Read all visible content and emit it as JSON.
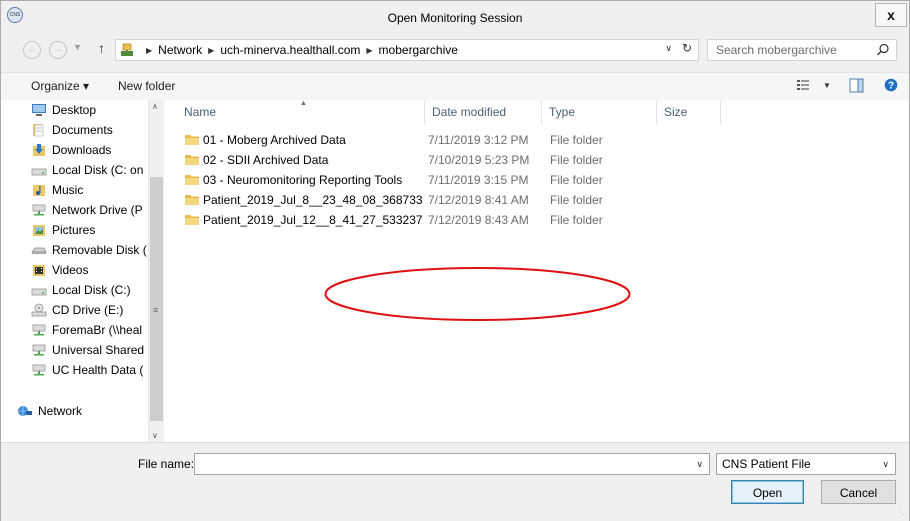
{
  "window": {
    "title": "Open Monitoring Session",
    "app_icon_text": "CNS",
    "close_label": "x"
  },
  "navbar": {
    "back_icon": "back-arrow-icon",
    "forward_icon": "forward-arrow-icon",
    "up_icon": "up-arrow-icon",
    "breadcrumbs": [
      "Network",
      "uch-minerva.healthall.com",
      "mobergarchive"
    ],
    "search_placeholder": "Search mobergarchive"
  },
  "toolbar": {
    "organize_label": "Organize ▾",
    "new_folder_label": "New folder"
  },
  "sidebar": {
    "items": [
      {
        "label": "Desktop",
        "icon": "desktop-icon"
      },
      {
        "label": "Documents",
        "icon": "documents-icon"
      },
      {
        "label": "Downloads",
        "icon": "downloads-icon"
      },
      {
        "label": "Local Disk (C: on",
        "icon": "drive-icon"
      },
      {
        "label": "Music",
        "icon": "music-icon"
      },
      {
        "label": "Network Drive (P",
        "icon": "network-drive-icon"
      },
      {
        "label": "Pictures",
        "icon": "pictures-icon"
      },
      {
        "label": "Removable Disk (",
        "icon": "removable-disk-icon"
      },
      {
        "label": "Videos",
        "icon": "videos-icon"
      },
      {
        "label": "Local Disk (C:)",
        "icon": "drive-icon"
      },
      {
        "label": "CD Drive (E:)",
        "icon": "cd-drive-icon"
      },
      {
        "label": "ForemaBr (\\\\heal",
        "icon": "network-drive-icon"
      },
      {
        "label": "Universal Shared",
        "icon": "network-drive-icon"
      },
      {
        "label": "UC Health Data (",
        "icon": "network-drive-icon"
      },
      {
        "label": "Network",
        "icon": "network-icon"
      }
    ]
  },
  "file_list": {
    "columns": [
      "Name",
      "Date modified",
      "Type",
      "Size"
    ],
    "rows": [
      {
        "name": "01 - Moberg Archived Data",
        "date": "7/11/2019 3:12 PM",
        "type": "File folder",
        "size": ""
      },
      {
        "name": "02 - SDII Archived Data",
        "date": "7/10/2019 5:23 PM",
        "type": "File folder",
        "size": ""
      },
      {
        "name": "03 - Neuromonitoring Reporting Tools",
        "date": "7/11/2019 3:15 PM",
        "type": "File folder",
        "size": ""
      },
      {
        "name": "Patient_2019_Jul_8__23_48_08_368733",
        "date": "7/12/2019 8:41 AM",
        "type": "File folder",
        "size": ""
      },
      {
        "name": "Patient_2019_Jul_12__8_41_27_533237",
        "date": "7/12/2019 8:43 AM",
        "type": "File folder",
        "size": ""
      }
    ]
  },
  "annotation": {
    "color": "#e01010"
  },
  "footer": {
    "file_name_label": "File name:",
    "file_name_value": "",
    "file_type_selected": "CNS Patient File",
    "open_label": "Open",
    "cancel_label": "Cancel"
  },
  "colors": {
    "accent": "#0078d7",
    "folder": "#e8b94a",
    "column_header": "#4c607a"
  }
}
